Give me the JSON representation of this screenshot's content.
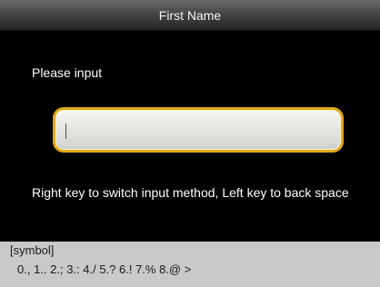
{
  "header": {
    "title": "First Name"
  },
  "form": {
    "prompt": "Please input",
    "input_value": "",
    "hint": "Right key to switch input method, Left key to back space"
  },
  "ime": {
    "mode": "[symbol]",
    "candidates": "0., 1.. 2.; 3.: 4./ 5.? 6.! 7.% 8.@ >"
  },
  "colors": {
    "input_border": "#e3a81a",
    "ime_background": "#c9c9c9",
    "screen_background": "#000000"
  }
}
